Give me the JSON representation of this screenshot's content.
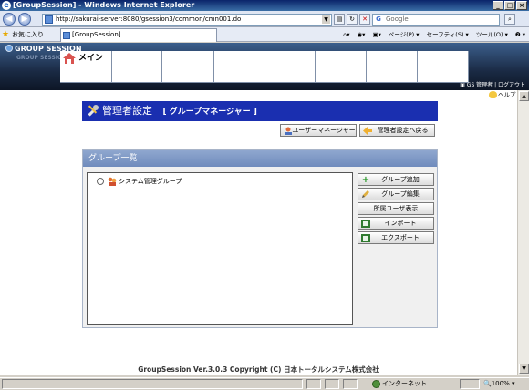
{
  "window": {
    "title": "[GroupSession] - Windows Internet Explorer",
    "controls": [
      "_",
      "□",
      "×"
    ]
  },
  "browser": {
    "url": "http://sakurai-server:8080/gsession3/common/cmn001.do",
    "search_placeholder": "Google",
    "favorites_label": "お気に入り",
    "tab_label": "[GroupSession]",
    "tools": [
      "ページ(P) ▾",
      "セーフティ(S) ▾",
      "ツール(O) ▾",
      "❷ ▾"
    ]
  },
  "gs_header": {
    "logo": "GROUP SESSION",
    "logo_sub": "GROUP SESSION",
    "main_label": "メイン",
    "user_info": "GS 管理者 | ログアウト"
  },
  "help_label": "ヘルプ",
  "admin": {
    "title": "管理者設定",
    "subtitle": "[ グループマネージャー ]",
    "user_manager_button": "ユーザーマネージャー",
    "back_button": "管理者設定へ戻る"
  },
  "group_panel": {
    "title": "グループ一覧",
    "groups": [
      "システム管理グループ"
    ],
    "buttons": {
      "add": "グループ追加",
      "edit": "グループ編集",
      "members": "所属ユーザ表示",
      "import": "インポート",
      "export": "エクスポート"
    }
  },
  "footer": "GroupSession Ver.3.0.3 Copyright (C) 日本トータルシステム株式会社",
  "status": {
    "zone": "インターネット",
    "zoom": "100%"
  },
  "colors": {
    "title_bar": "#1a2fb0",
    "panel_head": "#7d97c6",
    "header_dark": "#1a2a44"
  }
}
